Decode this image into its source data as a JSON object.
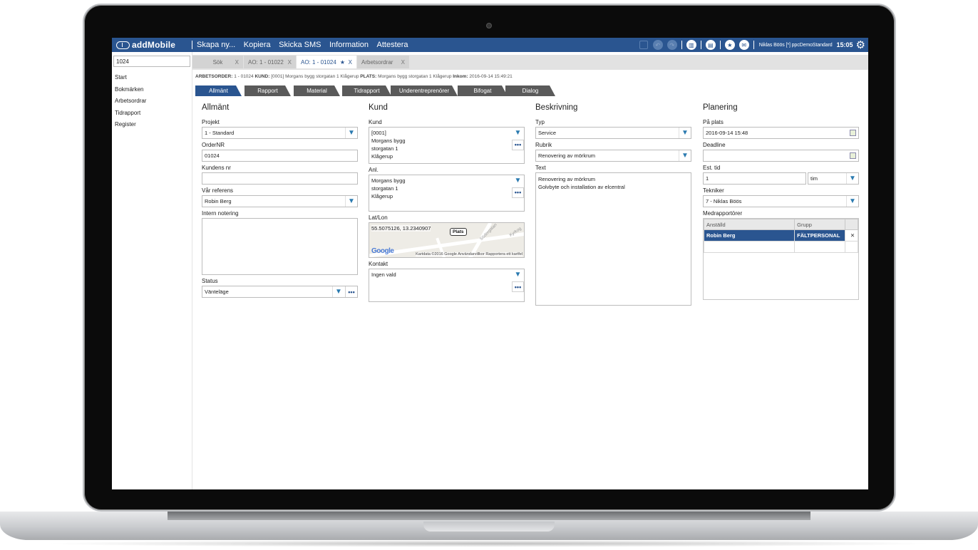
{
  "app": {
    "brand": "addMobile",
    "menu": [
      "Skapa ny...",
      "Kopiera",
      "Skicka SMS",
      "Information",
      "Attestera"
    ],
    "user": "Niklas Böös [*] ppcDemoStandard",
    "time": "15:05",
    "accent": "#2a5590"
  },
  "sidebar": {
    "search_value": "1024",
    "items": [
      "Start",
      "Bokmärken",
      "Arbetsordrar",
      "Tidrapport",
      "Register"
    ]
  },
  "tabs": {
    "search": {
      "label": "Sök",
      "close": "X"
    },
    "t1": {
      "label": "AO: 1 - 01022",
      "close": "X"
    },
    "t2": {
      "label": "AO: 1 - 01024",
      "star": "★",
      "close": "X"
    },
    "t3": {
      "label": "Arbetsordrar",
      "close": "X"
    }
  },
  "crumbs": {
    "k1": "ARBETSORDER:",
    "v1": "1 - 01024",
    "k2": "KUND:",
    "v2": "[0001] Morgans bygg storgatan 1 Klågerup",
    "k3": "PLATS:",
    "v3": "Morgans bygg storgatan 1 Klågerup",
    "k4": "Inkom:",
    "v4": "2016-09-14 15:49:21"
  },
  "sections": [
    "Allmänt",
    "Rapport",
    "Material",
    "Tidrapport",
    "Underentreprenörer",
    "Bifogat",
    "Dialog"
  ],
  "allmant": {
    "heading": "Allmänt",
    "projekt_label": "Projekt",
    "projekt": "1 - Standard",
    "ordernr_label": "OrderNR",
    "ordernr": "01024",
    "kundensnr_label": "Kundens nr",
    "kundensnr": "",
    "referens_label": "Vår referens",
    "referens": "Robin Berg",
    "notering_label": "Intern notering",
    "notering": "",
    "status_label": "Status",
    "status": "Vänteläge"
  },
  "kund": {
    "heading": "Kund",
    "kund_label": "Kund",
    "kund_lines": [
      "[0001]",
      "Morgans bygg",
      "storgatan 1",
      "Klågerup"
    ],
    "anl_label": "Anl.",
    "anl_lines": [
      "Morgans bygg",
      "storgatan 1",
      "Klågerup"
    ],
    "latlon_label": "Lat/Lon",
    "latlon": "55.5075126, 13.2340907",
    "map_pin": "Plats",
    "map_logo": "Google",
    "map_footer": "Kartdata ©2016 Google   Användarvillkor   Rapportera ett kartfel",
    "map_street1": "Södergatan",
    "map_street2": "Kyrkog",
    "kontakt_label": "Kontakt",
    "kontakt": "Ingen vald"
  },
  "beskrivning": {
    "heading": "Beskrivning",
    "typ_label": "Typ",
    "typ": "Service",
    "rubrik_label": "Rubrik",
    "rubrik": "Renovering av mörkrum",
    "text_label": "Text",
    "text_lines": [
      "Renovering av mörkrum",
      "Golvbyte och installation av elcentral"
    ]
  },
  "planering": {
    "heading": "Planering",
    "paplats_label": "På plats",
    "paplats": "2016-09-14 15:48",
    "deadline_label": "Deadline",
    "deadline": "",
    "esttid_label": "Est. tid",
    "esttid": "1",
    "esttid_unit": "tim",
    "tekniker_label": "Tekniker",
    "tekniker": "7 - Niklas Böös",
    "medrap_label": "Medrapportörer",
    "cols": [
      "Anställd",
      "Grupp"
    ],
    "rows": [
      {
        "anstalld": "Robin Berg",
        "grupp": "FÄLTPERSONAL",
        "del": "✕"
      }
    ]
  }
}
